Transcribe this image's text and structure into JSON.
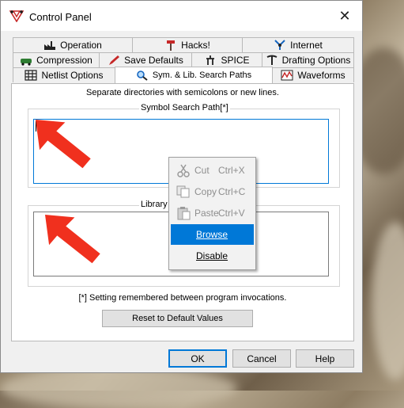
{
  "window": {
    "title": "Control Panel",
    "close_glyph": "✕"
  },
  "tabs": {
    "row1": [
      {
        "label": "Operation",
        "icon": "factory-icon"
      },
      {
        "label": "Hacks!",
        "icon": "hammer-icon"
      },
      {
        "label": "Internet",
        "icon": "network-icon"
      }
    ],
    "row2": [
      {
        "label": "Compression",
        "icon": "car-icon"
      },
      {
        "label": "Save Defaults",
        "icon": "pencil-icon"
      },
      {
        "label": "SPICE",
        "icon": "cmos-icon"
      },
      {
        "label": "Drafting Options",
        "icon": "pickaxe-icon"
      }
    ],
    "row3": [
      {
        "label": "Netlist Options",
        "icon": "grid-icon"
      },
      {
        "label": "Sym. & Lib. Search Paths",
        "icon": "magnifier-icon",
        "active": true
      },
      {
        "label": "Waveforms",
        "icon": "waveform-icon"
      }
    ]
  },
  "panel": {
    "hint": "Separate directories with semicolons or new lines.",
    "symbol_label": "Symbol Search Path[*]",
    "symbol_value": "",
    "library_label": "Library S",
    "library_value": "",
    "footnote": "[*] Setting remembered between program invocations.",
    "reset_label": "Reset to Default Values"
  },
  "buttons": {
    "ok": "OK",
    "cancel": "Cancel",
    "help": "Help"
  },
  "context_menu": [
    {
      "label": "Cut",
      "shortcut": "Ctrl+X",
      "icon": "scissors-icon",
      "enabled": false
    },
    {
      "label": "Copy",
      "shortcut": "Ctrl+C",
      "icon": "copy-icon",
      "enabled": false
    },
    {
      "label": "Paste",
      "shortcut": "Ctrl+V",
      "icon": "clipboard-icon",
      "enabled": false
    },
    {
      "label": "Browse",
      "shortcut": "",
      "enabled": true,
      "highlighted": true
    },
    {
      "label": "Disable",
      "shortcut": "",
      "enabled": true
    }
  ],
  "colors": {
    "accent": "#0078d7",
    "arrow": "#f0301e"
  }
}
